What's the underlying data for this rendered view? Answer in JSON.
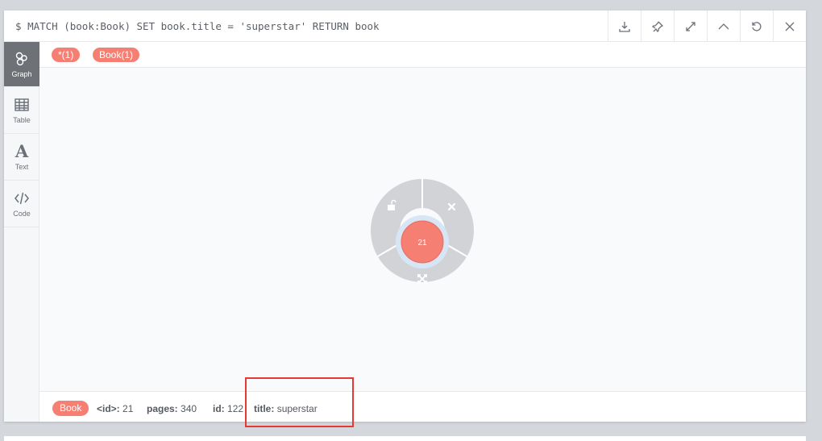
{
  "query": {
    "prompt": "$",
    "text": "MATCH (book:Book) SET book.title = 'superstar' RETURN book"
  },
  "toolbar": [
    {
      "icon": "download-icon"
    },
    {
      "icon": "pin-icon"
    },
    {
      "icon": "expand-icon"
    },
    {
      "icon": "collapse-icon"
    },
    {
      "icon": "rerun-icon"
    },
    {
      "icon": "close-icon"
    }
  ],
  "sidebar": {
    "graph": "Graph",
    "table": "Table",
    "text": "Text",
    "text_glyph": "A",
    "code": "Code"
  },
  "labels": {
    "all": "*(1)",
    "book": "Book(1)"
  },
  "node": {
    "caption": "21",
    "color": "#f57f73",
    "ring_color": "#d6e6f5",
    "menu_color": "#d1d3d6"
  },
  "properties": {
    "label": "Book",
    "id_key": "<id>:",
    "id_value": "21",
    "pages_key": "pages:",
    "pages_value": "340",
    "idprop_key": "id:",
    "idprop_value": "122",
    "title_key": "title:",
    "title_value": "superstar"
  }
}
